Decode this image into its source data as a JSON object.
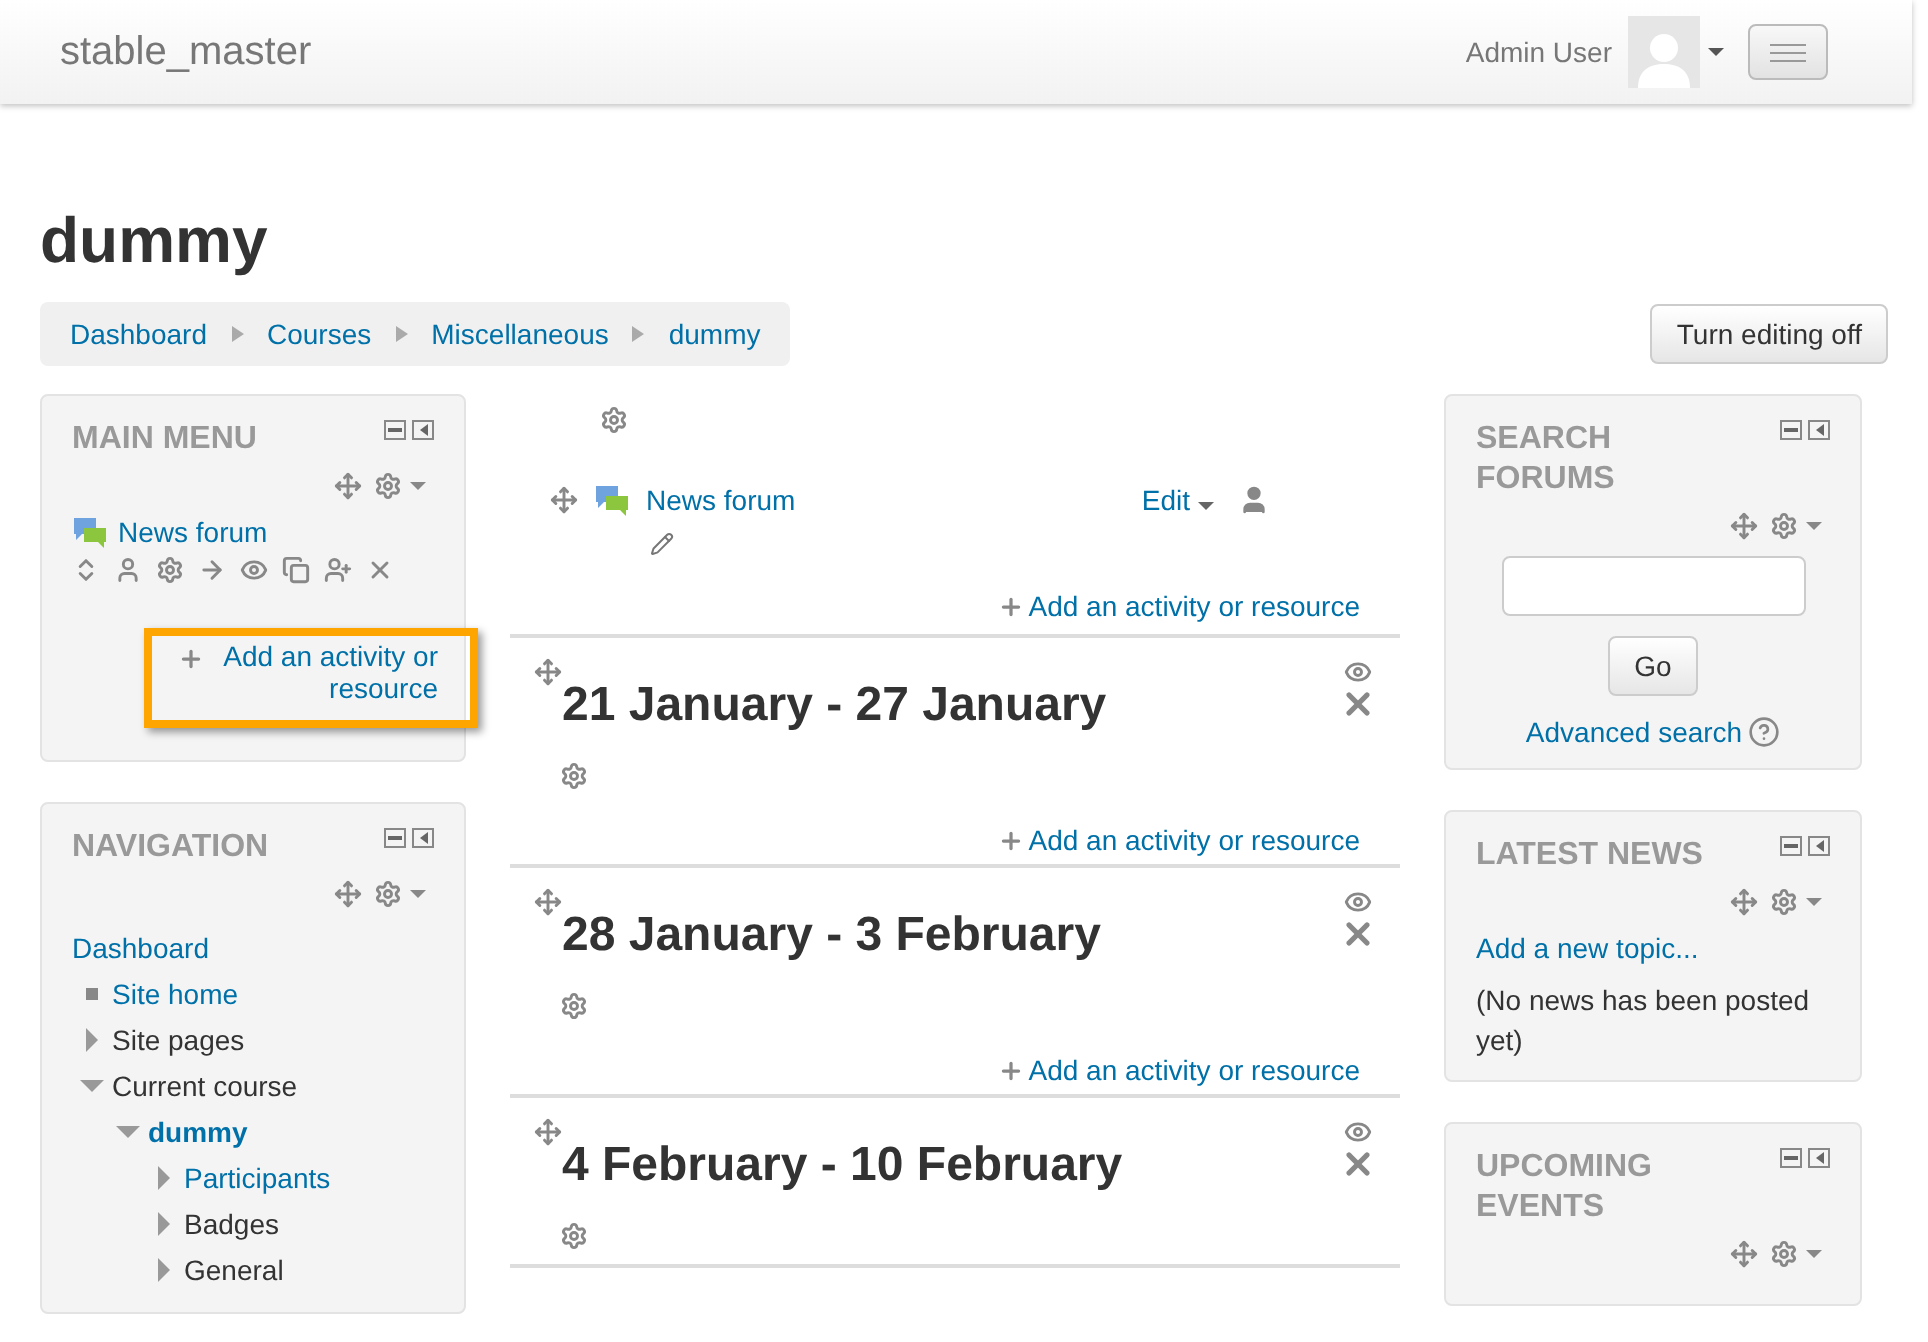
{
  "header": {
    "site_name": "stable_master",
    "user_name": "Admin User"
  },
  "page_title": "dummy",
  "breadcrumb": [
    "Dashboard",
    "Courses",
    "Miscellaneous",
    "dummy"
  ],
  "edit_button": "Turn editing off",
  "main_menu": {
    "title": "MAIN MENU",
    "item": "News forum",
    "add_link": "Add an activity or resource",
    "highlighted": true
  },
  "navigation": {
    "title": "NAVIGATION",
    "items": [
      {
        "label": "Dashboard",
        "kind": "plain",
        "link": true
      },
      {
        "label": "Site home",
        "kind": "leaf",
        "link": true
      },
      {
        "label": "Site pages",
        "kind": "branch",
        "link": false,
        "expanded": false
      },
      {
        "label": "Current course",
        "kind": "branch",
        "link": false,
        "expanded": true,
        "children": [
          {
            "label": "dummy",
            "kind": "branch",
            "link": true,
            "bold": true,
            "expanded": true,
            "children": [
              {
                "label": "Participants",
                "kind": "branch",
                "link": true,
                "expanded": false
              },
              {
                "label": "Badges",
                "kind": "branch",
                "link": false,
                "expanded": false
              },
              {
                "label": "General",
                "kind": "branch",
                "link": false,
                "expanded": false
              }
            ]
          }
        ]
      }
    ]
  },
  "intro_section": {
    "activity": "News forum",
    "edit_menu": "Edit",
    "add_link": "Add an activity or resource"
  },
  "weeks": [
    {
      "title": "21 January - 27 January",
      "add_link": "Add an activity or resource"
    },
    {
      "title": "28 January - 3 February",
      "add_link": "Add an activity or resource"
    },
    {
      "title": "4 February - 10 February"
    }
  ],
  "search_forums": {
    "title": "SEARCH FORUMS",
    "button": "Go",
    "advanced_link": "Advanced search"
  },
  "latest_news": {
    "title": "LATEST NEWS",
    "add_link": "Add a new topic...",
    "note": "(No news has been posted yet)"
  },
  "upcoming_events": {
    "title": "UPCOMING EVENTS"
  }
}
